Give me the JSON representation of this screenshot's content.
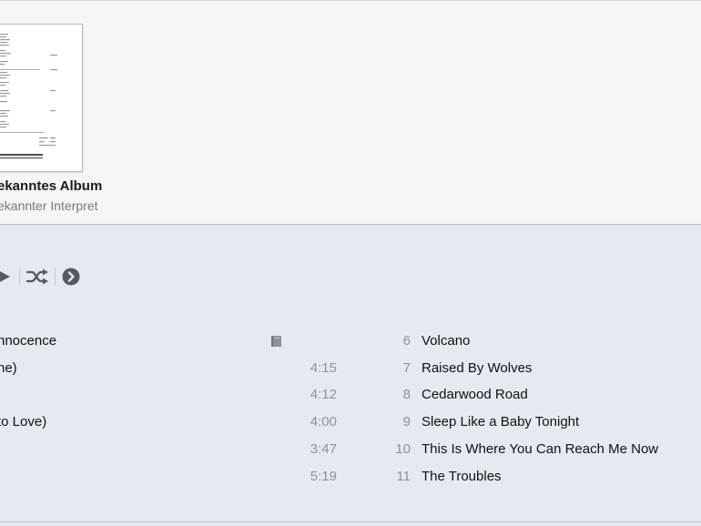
{
  "album": {
    "title": "ekanntes Album",
    "artist": "ekannter Interpret"
  },
  "controls": {
    "icons": [
      "play-icon",
      "shuffle-icon",
      "more-options-icon"
    ]
  },
  "left_tracks": [
    {
      "title": "nnocence",
      "duration": ""
    },
    {
      "title": "ne)",
      "duration": "4:15"
    },
    {
      "title": "",
      "duration": "4:12"
    },
    {
      "title": "to Love)",
      "duration": "4:00"
    },
    {
      "title": "",
      "duration": "3:47"
    },
    {
      "title": "",
      "duration": "5:19"
    }
  ],
  "right_tracks": [
    {
      "number": "6",
      "title": "Volcano"
    },
    {
      "number": "7",
      "title": "Raised By Wolves"
    },
    {
      "number": "8",
      "title": "Cedarwood Road"
    },
    {
      "number": "9",
      "title": "Sleep Like a Baby Tonight"
    },
    {
      "number": "10",
      "title": "This Is Where You Can Reach Me Now"
    },
    {
      "number": "11",
      "title": "The Troubles"
    }
  ],
  "colors": {
    "header_bg": "#f5f5f5",
    "list_bg": "#e5e9f0",
    "muted_text": "#8e9298"
  }
}
